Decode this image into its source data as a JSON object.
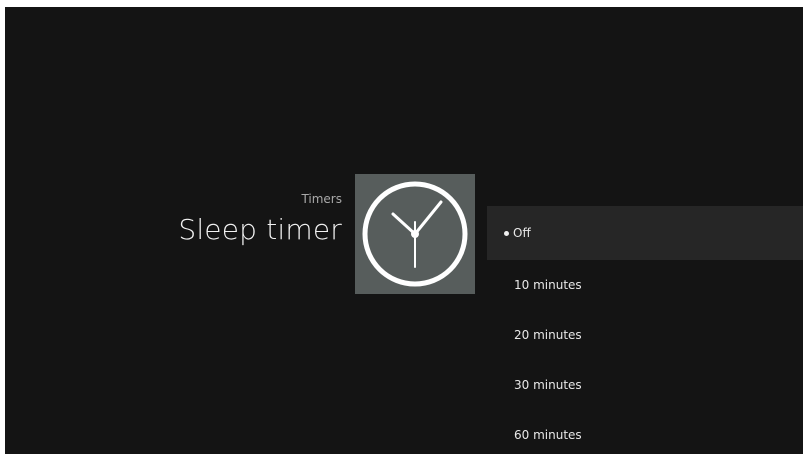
{
  "header": {
    "category": "Timers",
    "title": "Sleep timer"
  },
  "icon": {
    "name": "clock-icon",
    "tile_color": "#575d5c"
  },
  "options": [
    {
      "label": "Off",
      "selected": true
    },
    {
      "label": "10 minutes",
      "selected": false
    },
    {
      "label": "20 minutes",
      "selected": false
    },
    {
      "label": "30 minutes",
      "selected": false
    },
    {
      "label": "60 minutes",
      "selected": false
    }
  ],
  "colors": {
    "background": "#141414",
    "selected_row": "#262626"
  }
}
